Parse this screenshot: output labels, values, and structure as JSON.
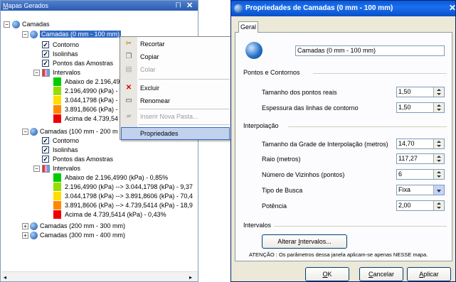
{
  "panel": {
    "title": "Mapas Gerados",
    "title_underline": "M",
    "title_rest": "apas Gerados",
    "pin_icon": "pin-icon",
    "close_icon": "close-icon",
    "root": "Camadas",
    "layer1": {
      "label": "Camadas (0 mm - 100 mm)",
      "children": [
        "Contorno",
        "Isolinhas",
        "Pontos das Amostras"
      ],
      "intervals_label": "Intervalos",
      "intervals": [
        {
          "text": "Abaixo de 2.196,49",
          "color": "#00cc00"
        },
        {
          "text": "2.196,4990 (kPa) -",
          "color": "#99dd00"
        },
        {
          "text": "3.044,1798 (kPa) -",
          "color": "#ffdd00"
        },
        {
          "text": "3.891,8606 (kPa) -",
          "color": "#ff8800"
        },
        {
          "text": "Acima de 4.739,54",
          "color": "#ee0000"
        }
      ]
    },
    "layer2": {
      "label": "Camadas (100 mm - 200 m",
      "children": [
        "Contorno",
        "Isolinhas",
        "Pontos das Amostras"
      ],
      "intervals_label": "Intervalos",
      "intervals": [
        {
          "text": "Abaixo de 2.196,4990 (kPa) - 0,85%",
          "color": "#00cc00"
        },
        {
          "text": "2.196,4990 (kPa) --> 3.044,1798 (kPa) - 9,37",
          "color": "#99dd00"
        },
        {
          "text": "3.044,1798 (kPa) --> 3.891,8606 (kPa) - 70,4",
          "color": "#ffdd00"
        },
        {
          "text": "3.891,8606 (kPa) --> 4.739,5414 (kPa) - 18,9",
          "color": "#ff8800"
        },
        {
          "text": "Acima de 4.739,5414 (kPa) - 0,43%",
          "color": "#ee0000"
        }
      ]
    },
    "layer3": "Camadas (200 mm - 300 mm)",
    "layer4": "Camadas (300 mm - 400 mm)"
  },
  "context_menu": {
    "items": [
      {
        "label": "Recortar",
        "icon": "scissors-icon",
        "enabled": true
      },
      {
        "label": "Copiar",
        "icon": "copy-icon",
        "enabled": true
      },
      {
        "label": "Colar",
        "icon": "paste-icon",
        "enabled": false
      },
      {
        "label": "Excluir",
        "icon": "delete-icon",
        "enabled": true
      },
      {
        "label": "Renomear",
        "icon": "rename-icon",
        "enabled": true
      },
      {
        "label": "Inserir Nova Pasta...",
        "icon": "folder-icon",
        "enabled": false
      },
      {
        "label": "Propriedades",
        "icon": "",
        "enabled": true
      }
    ]
  },
  "dialog": {
    "title": "Propriedades de Camadas (0 mm - 100 mm)",
    "tab": "Geral",
    "name_value": "Camadas (0 mm - 100 mm)",
    "group1": "Pontos e Contornos",
    "point_size_label": "Tamanho dos pontos reais",
    "point_size_value": "1,50",
    "line_width_label": "Espessura das linhas de contorno",
    "line_width_value": "1,50",
    "group2": "Interpolação",
    "grid_size_label": "Tamanho da Grade de Interpolação (metros)",
    "grid_size_value": "14,70",
    "radius_label": "Raio (metros)",
    "radius_value": "117,27",
    "neighbors_label": "Número de Vizinhos (pontos)",
    "neighbors_value": "6",
    "search_type_label": "Tipo de Busca",
    "search_type_value": "Fixa",
    "power_label": "Potência",
    "power_value": "2,00",
    "group3": "Intervalos",
    "alter_intervals_pre": "Alterar ",
    "alter_intervals_u": "I",
    "alter_intervals_post": "ntervalos...",
    "note": "ATENÇÃO : Os parâmetros dessa janela aplicam-se apenas NESSE mapa.",
    "ok_u": "O",
    "ok_rest": "K",
    "cancel_u": "C",
    "cancel_rest": "ancelar",
    "apply_u": "A",
    "apply_rest": "plicar"
  }
}
